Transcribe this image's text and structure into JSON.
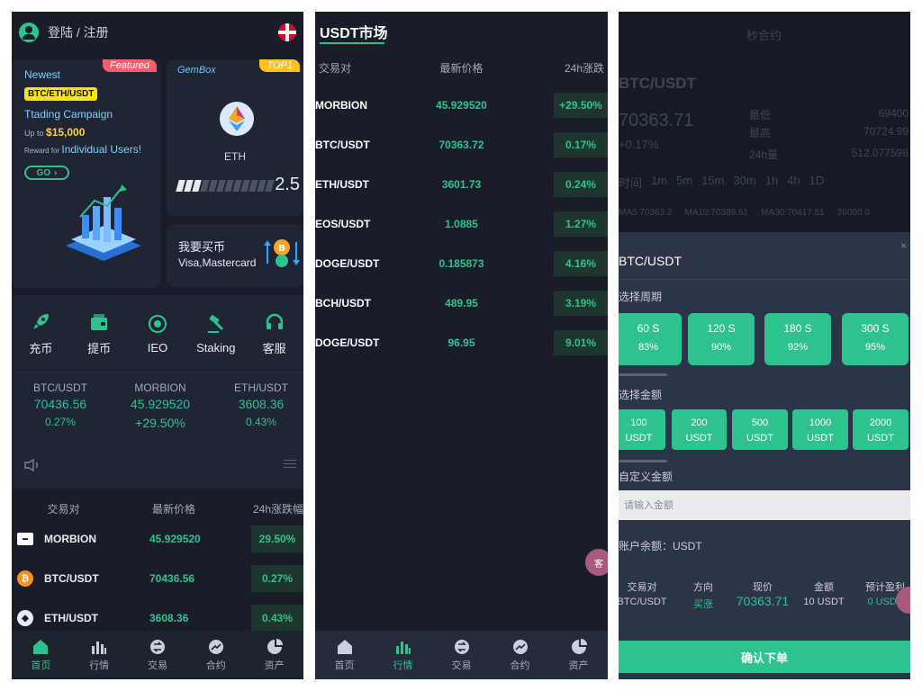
{
  "colors": {
    "accent": "#2ec28f",
    "bg": "#181d28",
    "card": "#1f2533",
    "sheet": "#2b3448"
  },
  "home": {
    "header": {
      "login_label": "登陆 / 注册"
    },
    "banner_left": {
      "tag": "Featured",
      "newest": "Newest",
      "pairs": "BTC/ETH/USDT",
      "title": "Ttading Campaign",
      "upto_prefix": "Up to",
      "upto_amount": "$15,000",
      "reward_prefix": "Reward for",
      "reward_target": "Individual Users!",
      "go": "GO"
    },
    "banner_right": {
      "brand": "GemBox",
      "tag": "TOP1",
      "coin": "ETH",
      "ratio": "2.5",
      "progress_filled": 3,
      "progress_total": 12
    },
    "buy_card": {
      "line1": "我要买币",
      "line2": "Visa,Mastercard"
    },
    "quick_actions": [
      {
        "label": "充币",
        "icon": "rocket-icon"
      },
      {
        "label": "提币",
        "icon": "wallet-icon"
      },
      {
        "label": "IEO",
        "icon": "ieo-icon"
      },
      {
        "label": "Staking",
        "icon": "hammer-icon"
      },
      {
        "label": "客服",
        "icon": "headset-icon"
      }
    ],
    "tickers": [
      {
        "pair": "BTC/USDT",
        "price": "70436.56",
        "change": "0.27%"
      },
      {
        "pair": "MORBION",
        "price": "45.929520",
        "change": "+29.50%"
      },
      {
        "pair": "ETH/USDT",
        "price": "3608.36",
        "change": "0.43%"
      }
    ],
    "market": {
      "headers": [
        "交易对",
        "最新价格",
        "24h涨跌幅"
      ],
      "rows": [
        {
          "pair": "MORBION",
          "price": "45.929520",
          "change": "29.50%",
          "icon": "morbion-icon"
        },
        {
          "pair": "BTC/USDT",
          "price": "70436.56",
          "change": "0.27%",
          "icon": "btc-icon"
        },
        {
          "pair": "ETH/USDT",
          "price": "3608.36",
          "change": "0.43%",
          "icon": "eth-icon"
        }
      ]
    },
    "tabbar": [
      {
        "label": "首页",
        "icon": "home-icon",
        "active": true
      },
      {
        "label": "行情",
        "icon": "chart-bars-icon",
        "active": false
      },
      {
        "label": "交易",
        "icon": "trade-icon",
        "active": false
      },
      {
        "label": "合约",
        "icon": "contract-icon",
        "active": false
      },
      {
        "label": "资产",
        "icon": "pie-icon",
        "active": false
      }
    ]
  },
  "market_page": {
    "title": "USDT市场",
    "headers": [
      "交易对",
      "最新价格",
      "24h涨跌"
    ],
    "rows": [
      {
        "pair": "MORBION",
        "price": "45.929520",
        "change": "+29.50%"
      },
      {
        "pair": "BTC/USDT",
        "price": "70363.72",
        "change": "0.17%"
      },
      {
        "pair": "ETH/USDT",
        "price": "3601.73",
        "change": "0.24%"
      },
      {
        "pair": "EOS/USDT",
        "price": "1.0885",
        "change": "1.27%"
      },
      {
        "pair": "DOGE/USDT",
        "price": "0.185873",
        "change": "4.16%"
      },
      {
        "pair": "BCH/USDT",
        "price": "489.95",
        "change": "3.19%"
      },
      {
        "pair": "DOGE/USDT",
        "price": "96.95",
        "change": "9.01%"
      }
    ],
    "float_label": "客",
    "tabbar": [
      {
        "label": "首页",
        "icon": "home-icon",
        "active": false
      },
      {
        "label": "行情",
        "icon": "chart-bars-icon",
        "active": true
      },
      {
        "label": "交易",
        "icon": "trade-icon",
        "active": false
      },
      {
        "label": "合约",
        "icon": "contract-icon",
        "active": false
      },
      {
        "label": "资产",
        "icon": "pie-icon",
        "active": false
      }
    ]
  },
  "contract_page": {
    "background": {
      "title": "秒合约",
      "pair": "BTC/USDT",
      "price": "70363.71",
      "change": "+0.17%",
      "stats": [
        {
          "label": "最低",
          "value": "69400"
        },
        {
          "label": "最高",
          "value": "70724.99"
        },
        {
          "label": "24h量",
          "value": "512.077598"
        }
      ],
      "periods": [
        "时间",
        "1m",
        "5m",
        "15m",
        "30m",
        "1h",
        "4h",
        "1D"
      ],
      "kline_info": [
        "MA5:70363.2",
        "MA10:70389.61",
        "MA30:70417.51",
        "26000.0"
      ]
    },
    "sheet": {
      "title": "BTC/USDT",
      "close": "×",
      "period_label": "选择周期",
      "periods": [
        {
          "duration": "60 S",
          "rate": "83%"
        },
        {
          "duration": "120 S",
          "rate": "90%"
        },
        {
          "duration": "180 S",
          "rate": "92%"
        },
        {
          "duration": "300 S",
          "rate": "95%"
        }
      ],
      "amount_label": "选择金额",
      "amounts": [
        {
          "value": "100",
          "unit": "USDT"
        },
        {
          "value": "200",
          "unit": "USDT"
        },
        {
          "value": "500",
          "unit": "USDT"
        },
        {
          "value": "1000",
          "unit": "USDT"
        },
        {
          "value": "2000",
          "unit": "USDT"
        }
      ],
      "custom_label": "自定义金额",
      "custom_placeholder": "请输入金额",
      "balance": "账户余额：USDT",
      "order_headers": [
        "交易对",
        "方向",
        "现价",
        "金额",
        "预计盈利"
      ],
      "order_values": [
        "BTC/USDT",
        "买涨",
        "70363.71",
        "10 USDT",
        "0 USDT"
      ],
      "confirm": "确认下单"
    }
  }
}
